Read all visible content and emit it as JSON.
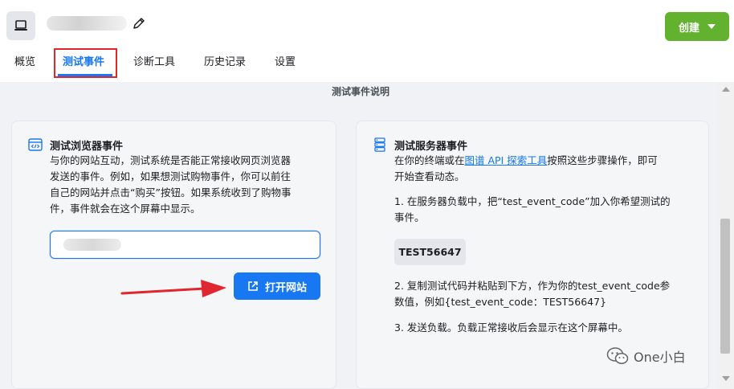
{
  "header": {
    "create_label": "创建"
  },
  "tabs": [
    {
      "label": "概览"
    },
    {
      "label": "测试事件"
    },
    {
      "label": "诊断工具"
    },
    {
      "label": "历史记录"
    },
    {
      "label": "设置"
    }
  ],
  "section_title": "测试事件说明",
  "browser_card": {
    "title": "测试浏览器事件",
    "description_lines": [
      "与你的网站互动，测试系统是否能正常接收网页浏览器",
      "发送的事件。例如，如果想测试购物事件，你可以前往",
      "自己的网站并点击“购买”按钮。如果系统收到了购物事",
      "件，事件就会在这个屏幕中显示。"
    ],
    "open_button_label": "打开网站"
  },
  "server_card": {
    "title": "测试服务器事件",
    "intro_prefix": "在你的终端或在",
    "intro_link": "图谱 API 探索工具",
    "intro_suffix": "按照这些步骤操作，即可",
    "intro_line2": "开始查看动态。",
    "step1_line1": "1. 在服务器负载中，把“test_event_code”加入你希望测试的",
    "step1_line2": "事件。",
    "test_code": "TEST56647",
    "step2_line1": "2. 复制测试代码并粘贴到下方，作为你的test_event_code参",
    "step2_line2": "数值，例如{test_event_code：TEST56647}",
    "step3": "3. 发送负载。负载正常接收后会显示在这个屏幕中。"
  },
  "watermark": {
    "text": "One小白"
  },
  "colors": {
    "accent": "#1877f2",
    "create_green": "#62b22f",
    "highlight_red": "#e0262f"
  }
}
